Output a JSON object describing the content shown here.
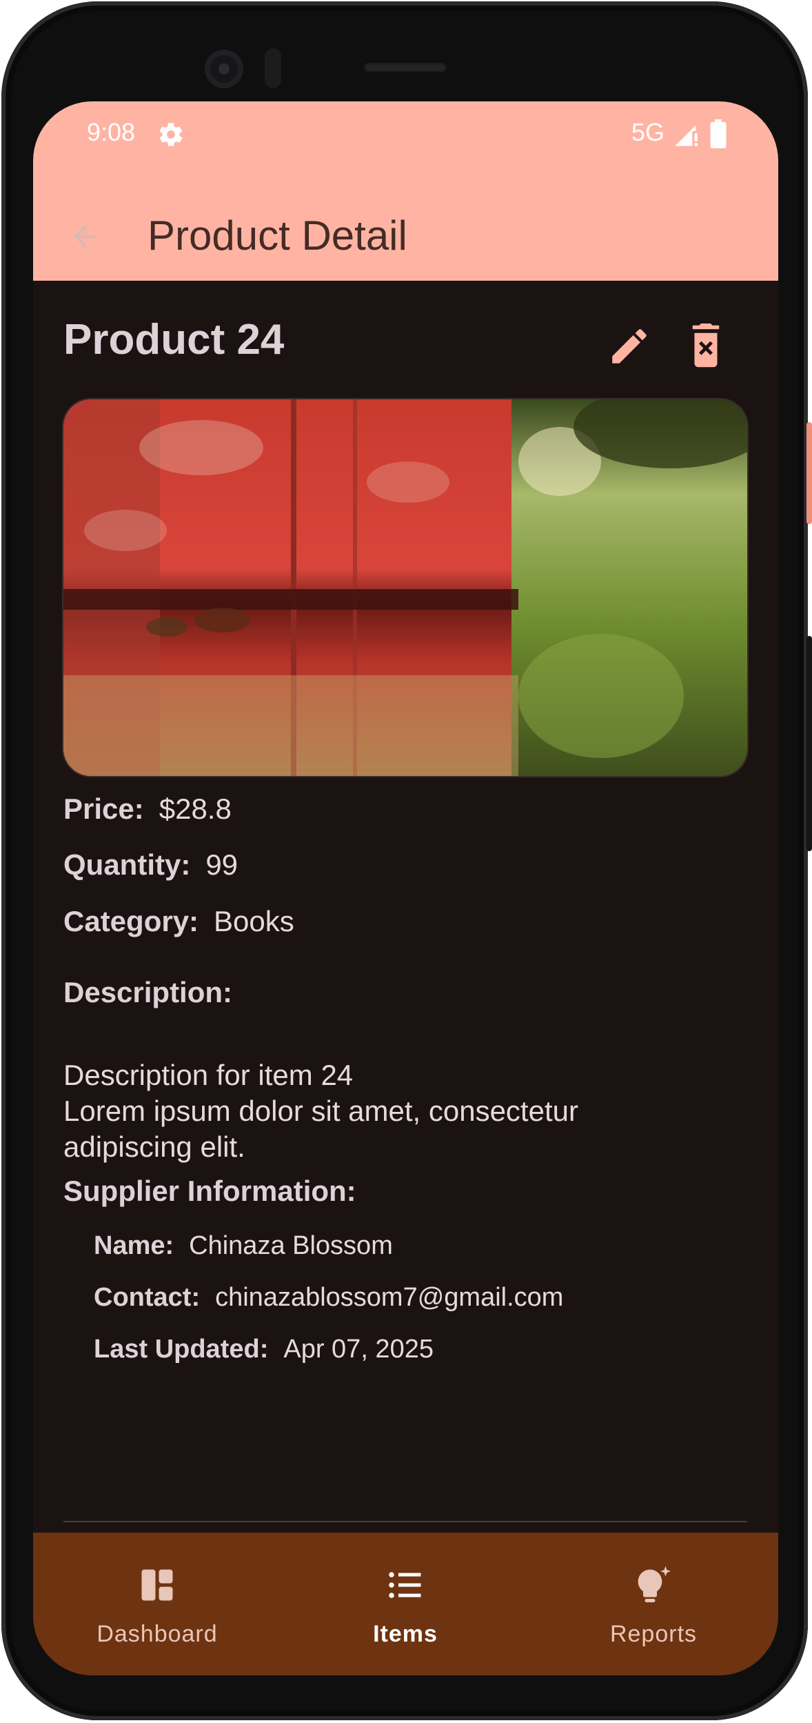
{
  "status_bar": {
    "time": "9:08",
    "network": "5G"
  },
  "app_bar": {
    "title": "Product Detail"
  },
  "product": {
    "title": "Product 24",
    "price_label": "Price:",
    "price_value": "$28.8",
    "quantity_label": "Quantity:",
    "quantity_value": "99",
    "category_label": "Category:",
    "category_value": "Books",
    "description_label": "Description:",
    "description_value": "Description for item 24\nLorem ipsum dolor sit amet, consectetur adipiscing elit."
  },
  "supplier": {
    "heading": "Supplier Information:",
    "name_label": "Name:",
    "name_value": "Chinaza Blossom",
    "contact_label": "Contact:",
    "contact_value": "chinazablossom7@gmail.com",
    "updated_label": "Last Updated:",
    "updated_value": "Apr 07, 2025"
  },
  "nav": {
    "items": [
      {
        "label": "Dashboard",
        "icon": "dashboard-icon",
        "active": false
      },
      {
        "label": "Items",
        "icon": "list-icon",
        "active": true
      },
      {
        "label": "Reports",
        "icon": "lightbulb-icon",
        "active": false
      }
    ]
  },
  "colors": {
    "accent": "#ffb4a3",
    "background": "#1b1312",
    "nav_background": "#6e3310"
  }
}
